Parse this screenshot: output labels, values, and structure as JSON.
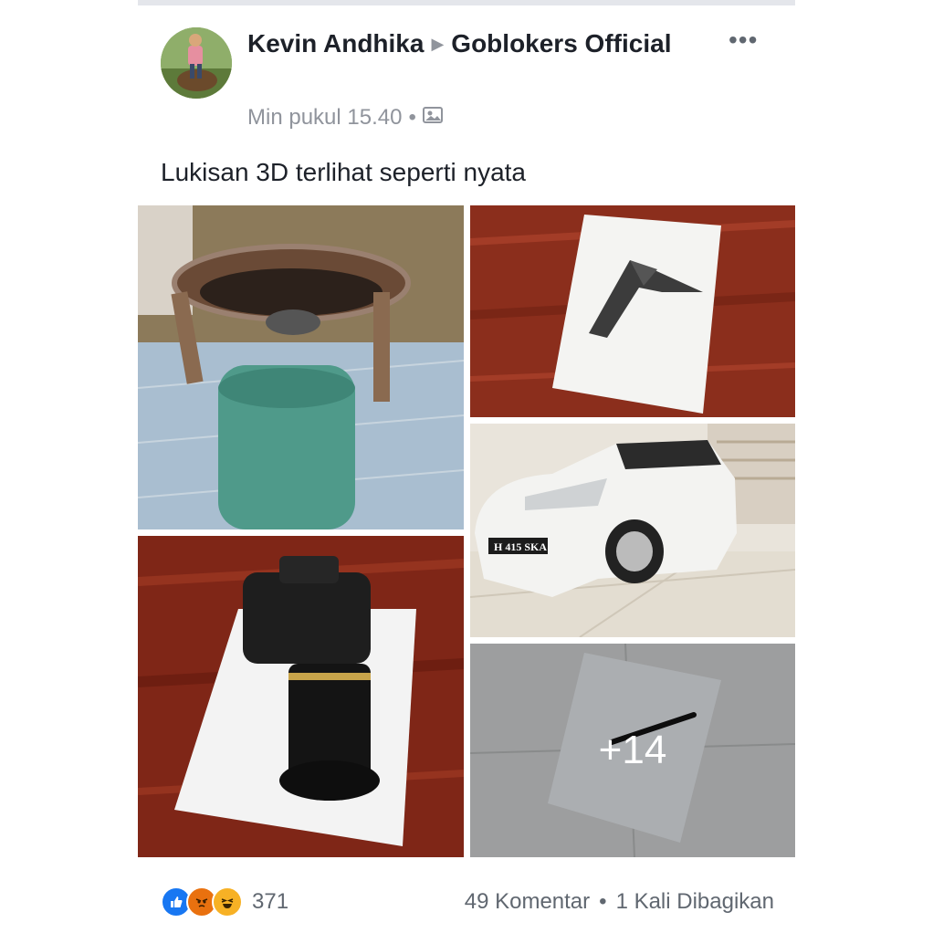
{
  "post": {
    "author": "Kevin Andhika",
    "group": "Goblokers Official",
    "timestamp": "Min pukul 15.40",
    "privacy_icon": "photo-icon",
    "caption": "Lukisan 3D terlihat seperti nyata",
    "more_icon": "more-options-icon"
  },
  "photos": {
    "more_count": "+14",
    "plate_text": "H 415 SKA"
  },
  "footer": {
    "reaction_icons": [
      "like-icon",
      "angry-icon",
      "haha-icon"
    ],
    "reaction_count": "371",
    "comments": "49 Komentar",
    "shares": "1 Kali Dibagikan"
  },
  "colors": {
    "like": "#1877f2",
    "angry": "#e9710f",
    "haha": "#f7b125"
  }
}
